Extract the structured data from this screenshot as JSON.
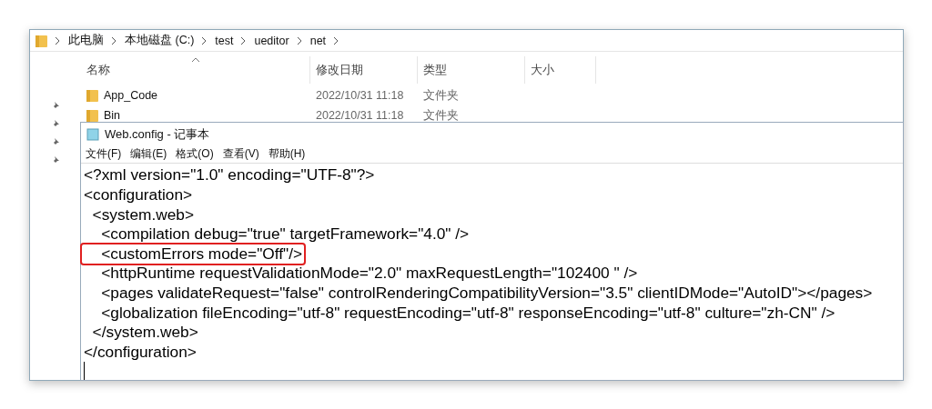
{
  "explorer": {
    "breadcrumb": [
      "此电脑",
      "本地磁盘 (C:)",
      "test",
      "ueditor",
      "net"
    ],
    "columns": [
      {
        "label": "名称",
        "sorted": true
      },
      {
        "label": "修改日期",
        "sorted": false
      },
      {
        "label": "类型",
        "sorted": false
      },
      {
        "label": "大小",
        "sorted": false
      }
    ],
    "rows": [
      {
        "name": "App_Code",
        "modified": "2022/10/31 11:18",
        "type": "文件夹"
      },
      {
        "name": "Bin",
        "modified": "2022/10/31 11:18",
        "type": "文件夹"
      }
    ]
  },
  "notepad": {
    "title": "Web.config - 记事本",
    "menu": [
      "文件(F)",
      "编辑(E)",
      "格式(O)",
      "查看(V)",
      "帮助(H)"
    ],
    "lines": [
      {
        "text": "<?xml version=\"1.0\" encoding=\"UTF-8\"?>",
        "highlighted": false
      },
      {
        "text": "<configuration>",
        "highlighted": false
      },
      {
        "text": "  <system.web>",
        "highlighted": false
      },
      {
        "text": "    <compilation debug=\"true\" targetFramework=\"4.0\" />",
        "highlighted": false
      },
      {
        "text": "    <customErrors mode=\"Off\"/>",
        "highlighted": true
      },
      {
        "text": "    <httpRuntime requestValidationMode=\"2.0\" maxRequestLength=\"102400 \" />",
        "highlighted": false
      },
      {
        "text": "    <pages validateRequest=\"false\" controlRenderingCompatibilityVersion=\"3.5\" clientIDMode=\"AutoID\"></pages>",
        "highlighted": false
      },
      {
        "text": "    <globalization fileEncoding=\"utf-8\" requestEncoding=\"utf-8\" responseEncoding=\"utf-8\" culture=\"zh-CN\" />",
        "highlighted": false
      },
      {
        "text": "  </system.web>",
        "highlighted": false
      },
      {
        "text": "</configuration>",
        "highlighted": false
      }
    ]
  }
}
